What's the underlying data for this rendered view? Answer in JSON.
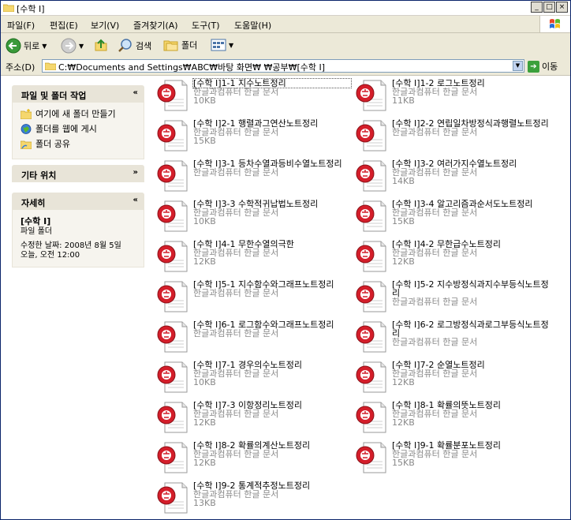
{
  "window": {
    "title": "[수학 I]"
  },
  "menu": [
    "파일(F)",
    "편집(E)",
    "보기(V)",
    "즐겨찾기(A)",
    "도구(T)",
    "도움말(H)"
  ],
  "toolbar": {
    "back": "뒤로",
    "search": "검색",
    "folders": "폴더"
  },
  "address": {
    "label": "주소(D)",
    "path": "C:₩Documents and Settings₩ABC₩바탕 화면₩ ₩공부₩[수학 I]",
    "go": "이동"
  },
  "left_pane": {
    "tasks": {
      "title": "파일 및 폴더 작업",
      "items": [
        "여기에 새 폴더 만들기",
        "폴더를 웹에 게시",
        "폴더 공유"
      ]
    },
    "other": {
      "title": "기타 위치"
    },
    "details": {
      "title": "자세히",
      "name": "[수학 I]",
      "kind": "파일 폴더",
      "modified_1": "수정한 날짜: 2008년 8월 5일",
      "modified_2": "오늘, 오전 12:00"
    }
  },
  "files": [
    {
      "name": "[수학 I]1-1 지수노트정리",
      "type": "한글과컴퓨터 한글 문서",
      "size": "10KB"
    },
    {
      "name": "[수학 I]1-2 로그노트정리",
      "type": "한글과컴퓨터 한글 문서",
      "size": "11KB"
    },
    {
      "name": "[수학 I]2-1 행렬과그연산노트정리",
      "type": "한글과컴퓨터 한글 문서",
      "size": "15KB"
    },
    {
      "name": "[수학 I]2-2 연립일차방정식과행렬노트정리",
      "type": "한글과컴퓨터 한글 문서",
      "size": ""
    },
    {
      "name": "[수학 I]3-1 등차수열과등비수열노트정리",
      "type": "한글과컴퓨터 한글 문서",
      "size": ""
    },
    {
      "name": "[수학 I]3-2 여러가지수열노트정리",
      "type": "한글과컴퓨터 한글 문서",
      "size": "14KB"
    },
    {
      "name": "[수학 I]3-3 수학적귀납법노트정리",
      "type": "한글과컴퓨터 한글 문서",
      "size": "10KB"
    },
    {
      "name": "[수학 I]3-4 알고리즘과순서도노트정리",
      "type": "한글과컴퓨터 한글 문서",
      "size": "15KB"
    },
    {
      "name": "[수학 I]4-1 무한수열의극한",
      "type": "한글과컴퓨터 한글 문서",
      "size": "12KB"
    },
    {
      "name": "[수학 I]4-2 무한급수노트정리",
      "type": "한글과컴퓨터 한글 문서",
      "size": "12KB"
    },
    {
      "name": "[수학 I]5-1 지수함수와그래프노트정리",
      "type": "한글과컴퓨터 한글 문서",
      "size": ""
    },
    {
      "name": "[수학 I]5-2 지수방정식과지수부등식노트정리",
      "type": "한글과컴퓨터 한글 문서",
      "size": ""
    },
    {
      "name": "[수학 I]6-1 로그함수와그래프노트정리",
      "type": "한글과컴퓨터 한글 문서",
      "size": ""
    },
    {
      "name": "[수학 I]6-2 로그방정식과로그부등식노트정리",
      "type": "한글과컴퓨터 한글 문서",
      "size": ""
    },
    {
      "name": "[수학 I]7-1 경우의수노트정리",
      "type": "한글과컴퓨터 한글 문서",
      "size": "10KB"
    },
    {
      "name": "[수학 I]7-2 순열노트정리",
      "type": "한글과컴퓨터 한글 문서",
      "size": "12KB"
    },
    {
      "name": "[수학 I]7-3 이항정리노트정리",
      "type": "한글과컴퓨터 한글 문서",
      "size": "12KB"
    },
    {
      "name": "[수학 I]8-1 확률의뜻노트정리",
      "type": "한글과컴퓨터 한글 문서",
      "size": "12KB"
    },
    {
      "name": "[수학 I]8-2 확률의계산노트정리",
      "type": "한글과컴퓨터 한글 문서",
      "size": "12KB"
    },
    {
      "name": "[수학 I]9-1 확률분포노트정리",
      "type": "한글과컴퓨터 한글 문서",
      "size": "15KB"
    },
    {
      "name": "[수학 I]9-2 통계적추정노트정리",
      "type": "한글과컴퓨터 한글 문서",
      "size": "13KB"
    }
  ]
}
